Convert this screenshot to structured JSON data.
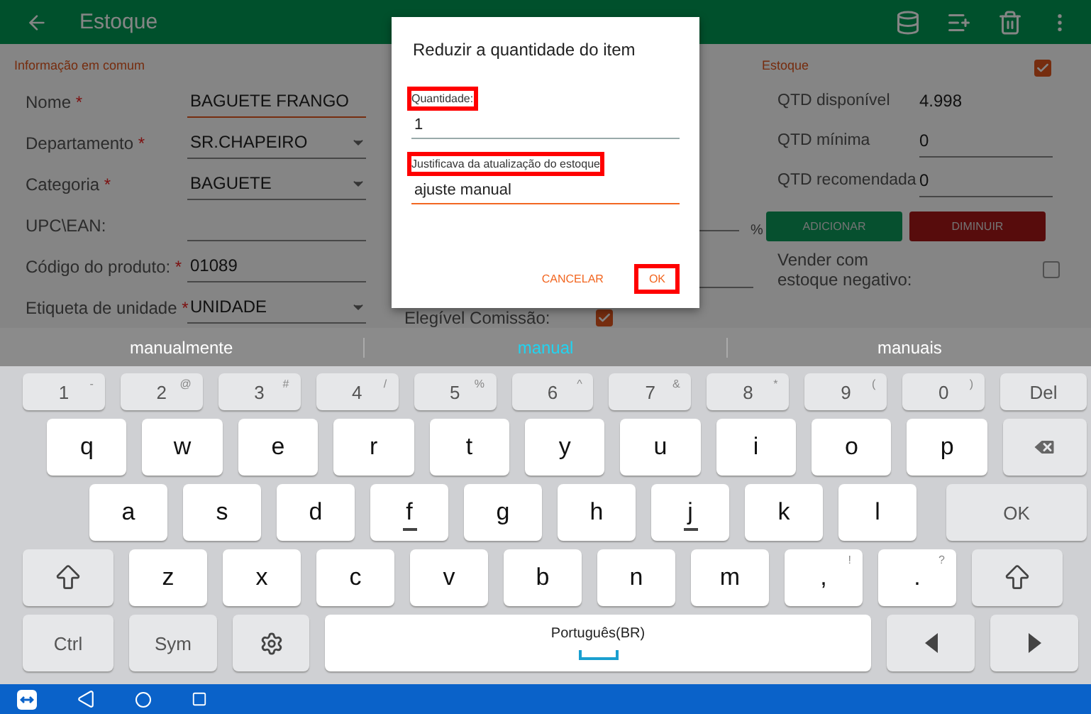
{
  "app_bar": {
    "title": "Estoque"
  },
  "common_section": {
    "title": "Informação em comum",
    "fields": [
      {
        "label": "Nome",
        "required": true,
        "value": "BAGUETE FRANGO",
        "kind": "text",
        "focused": true
      },
      {
        "label": "Departamento",
        "required": true,
        "value": "SR.CHAPEIRO",
        "kind": "dropdown",
        "focused": false
      },
      {
        "label": "Categoria",
        "required": true,
        "value": "BAGUETE",
        "kind": "dropdown",
        "focused": false
      },
      {
        "label": "UPC\\EAN:",
        "required": false,
        "kind": "text",
        "focused": false
      },
      {
        "label": "Código do produto:",
        "required": true,
        "value": "01089",
        "kind": "text",
        "focused": false
      },
      {
        "label": "Etiqueta de unidade",
        "required": true,
        "value": "UNIDADE",
        "kind": "dropdown",
        "focused": false
      }
    ]
  },
  "middle_section": {
    "percent_suffix": "%",
    "commission": {
      "label": "Elegível Comissão:",
      "checked": true
    }
  },
  "stock_section": {
    "title": "Estoque",
    "checked": true,
    "rows": [
      {
        "label": "QTD disponível",
        "value": "4.998"
      },
      {
        "label": "QTD mínima",
        "value": "0"
      },
      {
        "label": "QTD recomendada",
        "value": "0"
      }
    ],
    "add_button": "ADICIONAR",
    "reduce_button": "DIMINUIR",
    "negative": {
      "label": "Vender com estoque negativo:",
      "checked": false
    }
  },
  "dialog": {
    "title": "Reduzir a quantidade do item",
    "fields": [
      {
        "label": "Quantidade:",
        "value": "1",
        "highlighted": true,
        "focused": false
      },
      {
        "label": "Justificava da atualização do estoque",
        "value": "ajuste manual",
        "highlighted": true,
        "focused": true
      }
    ],
    "buttons": [
      {
        "label": "CANCELAR",
        "highlighted": false
      },
      {
        "label": "OK",
        "highlighted": true
      }
    ]
  },
  "keyboard": {
    "suggestions": [
      {
        "text": "manualmente",
        "selected": false
      },
      {
        "text": "manual",
        "selected": true
      },
      {
        "text": "manuais",
        "selected": false
      }
    ],
    "key_rows": [
      {
        "keys": [
          {
            "kind": "number",
            "label": "1",
            "secondary": "-"
          },
          {
            "kind": "number",
            "label": "2",
            "secondary": "@"
          },
          {
            "kind": "number",
            "label": "3",
            "secondary": "#"
          },
          {
            "kind": "number",
            "label": "4",
            "secondary": "/"
          },
          {
            "kind": "number",
            "label": "5",
            "secondary": "%"
          },
          {
            "kind": "number",
            "label": "6",
            "secondary": "^"
          },
          {
            "kind": "number",
            "label": "7",
            "secondary": "&"
          },
          {
            "kind": "number",
            "label": "8",
            "secondary": "*"
          },
          {
            "kind": "number",
            "label": "9",
            "secondary": "("
          },
          {
            "kind": "number",
            "label": "0",
            "secondary": ")"
          },
          {
            "kind": "action",
            "label": "Del"
          }
        ]
      },
      {
        "keys": [
          {
            "kind": "letter",
            "label": "q"
          },
          {
            "kind": "letter",
            "label": "w"
          },
          {
            "kind": "letter",
            "label": "e"
          },
          {
            "kind": "letter",
            "label": "r"
          },
          {
            "kind": "letter",
            "label": "t"
          },
          {
            "kind": "letter",
            "label": "y"
          },
          {
            "kind": "letter",
            "label": "u"
          },
          {
            "kind": "letter",
            "label": "i"
          },
          {
            "kind": "letter",
            "label": "o"
          },
          {
            "kind": "letter",
            "label": "p"
          },
          {
            "kind": "backspace"
          }
        ]
      },
      {
        "keys": [
          {
            "kind": "letter",
            "label": "a"
          },
          {
            "kind": "letter",
            "label": "s"
          },
          {
            "kind": "letter",
            "label": "d"
          },
          {
            "kind": "letter",
            "label": "f",
            "bump": true
          },
          {
            "kind": "letter",
            "label": "g"
          },
          {
            "kind": "letter",
            "label": "h"
          },
          {
            "kind": "letter",
            "label": "j",
            "bump": true
          },
          {
            "kind": "letter",
            "label": "k"
          },
          {
            "kind": "letter",
            "label": "l"
          },
          {
            "kind": "action",
            "label": "OK"
          }
        ]
      },
      {
        "keys": [
          {
            "kind": "shift"
          },
          {
            "kind": "letter",
            "label": "z"
          },
          {
            "kind": "letter",
            "label": "x"
          },
          {
            "kind": "letter",
            "label": "c"
          },
          {
            "kind": "letter",
            "label": "v"
          },
          {
            "kind": "letter",
            "label": "b"
          },
          {
            "kind": "letter",
            "label": "n"
          },
          {
            "kind": "letter",
            "label": "m"
          },
          {
            "kind": "letter",
            "label": ",",
            "secondary": "!"
          },
          {
            "kind": "letter",
            "label": ".",
            "secondary": "?"
          },
          {
            "kind": "shift"
          }
        ]
      },
      {
        "keys": [
          {
            "kind": "action",
            "label": "Ctrl"
          },
          {
            "kind": "action",
            "label": "Sym"
          },
          {
            "kind": "settings"
          },
          {
            "kind": "space",
            "label": "Português(BR)"
          },
          {
            "kind": "left"
          },
          {
            "kind": "right"
          }
        ]
      }
    ]
  }
}
